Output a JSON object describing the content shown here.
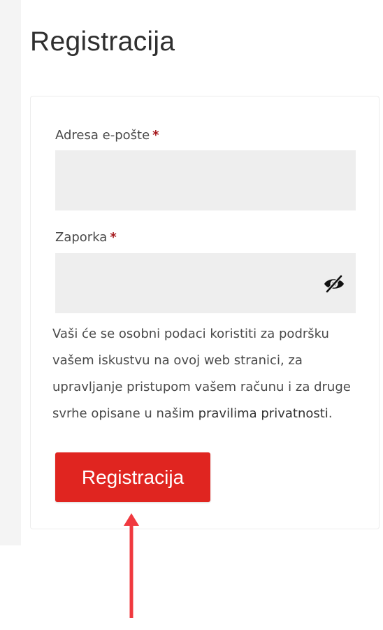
{
  "page": {
    "title": "Registracija"
  },
  "form": {
    "email": {
      "label": "Adresa e-pošte",
      "required_mark": "*",
      "value": "",
      "placeholder": ""
    },
    "password": {
      "label": "Zaporka",
      "required_mark": "*",
      "value": "",
      "placeholder": "",
      "toggle_icon": "eye-slash-icon"
    },
    "privacy": {
      "text": "Vaši će se osobni podaci koristiti za podršku vašem iskustvu na ovoj web stranici, za upravljanje pristupom vašem računu i za druge svrhe opisane u našim ",
      "link_text": "pravilima privatnosti",
      "suffix": "."
    },
    "submit_label": "Registracija"
  },
  "colors": {
    "accent": "#e02520",
    "required": "#a4161a",
    "input_bg": "#eeeeee",
    "annotation_arrow": "#f0393f"
  }
}
